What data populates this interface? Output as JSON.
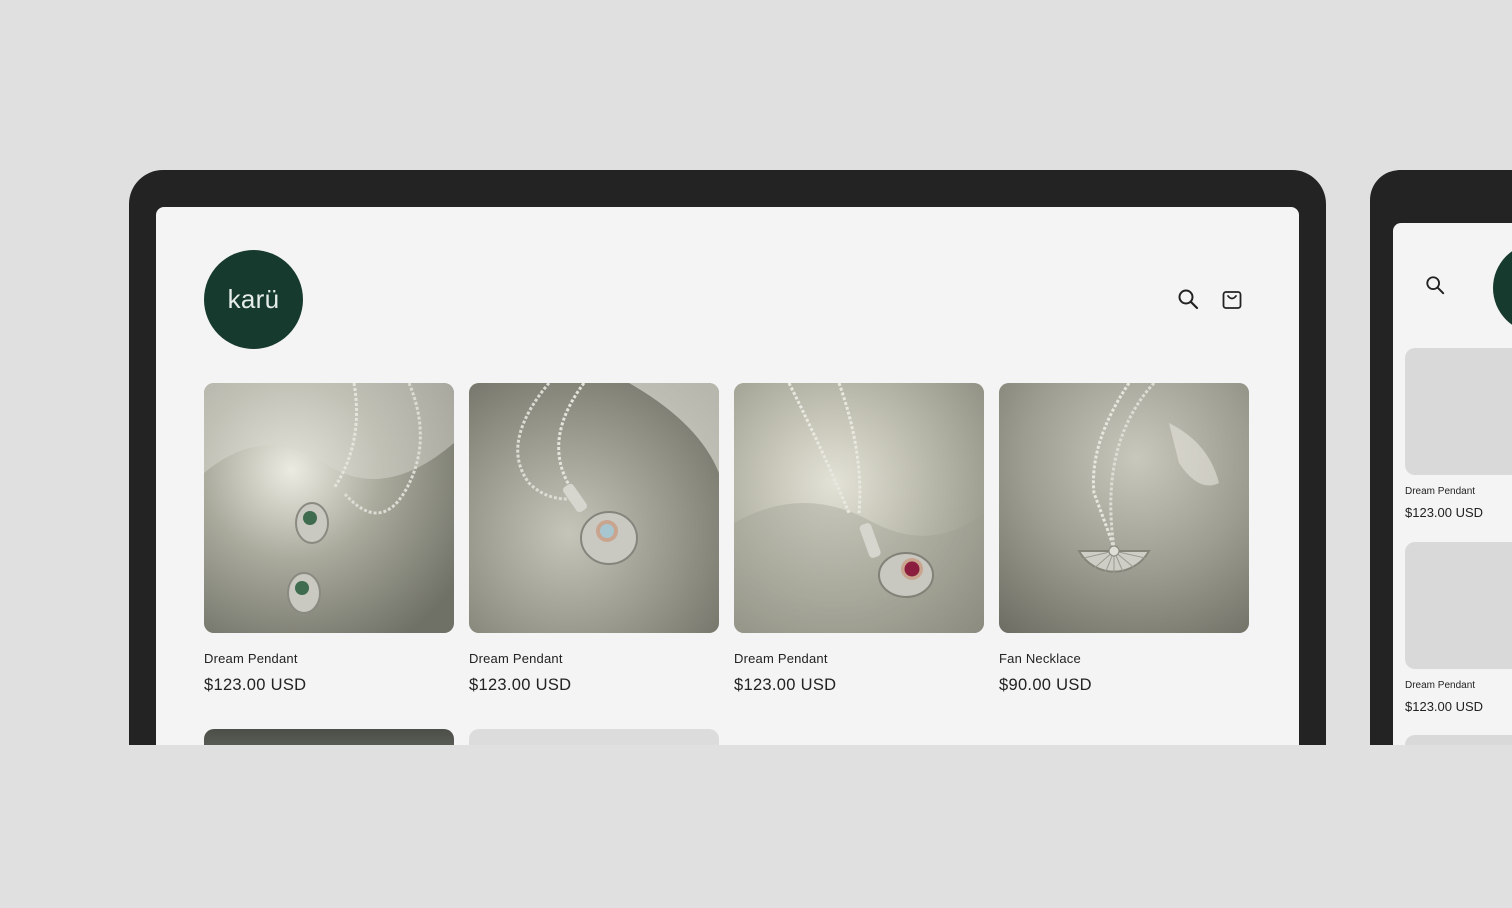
{
  "store": {
    "logo_text": "karü",
    "brand_color": "#163a2e"
  },
  "header": {
    "search_icon": "search-icon",
    "cart_icon": "cart-bag-icon"
  },
  "products": [
    {
      "title": "Dream Pendant",
      "price": "$123.00 USD",
      "stone_color": "#3f6b4f"
    },
    {
      "title": "Dream Pendant",
      "price": "$123.00 USD",
      "stone_color": "#a7c6cf"
    },
    {
      "title": "Dream Pendant",
      "price": "$123.00 USD",
      "stone_color": "#8b1e3f"
    },
    {
      "title": "Fan Necklace",
      "price": "$90.00 USD",
      "stone_color": ""
    }
  ],
  "side_device": {
    "products": [
      {
        "title": "Dream Pendant",
        "price": "$123.00 USD"
      },
      {
        "title": "Dream Pendant",
        "price": "$123.00 USD"
      }
    ]
  }
}
